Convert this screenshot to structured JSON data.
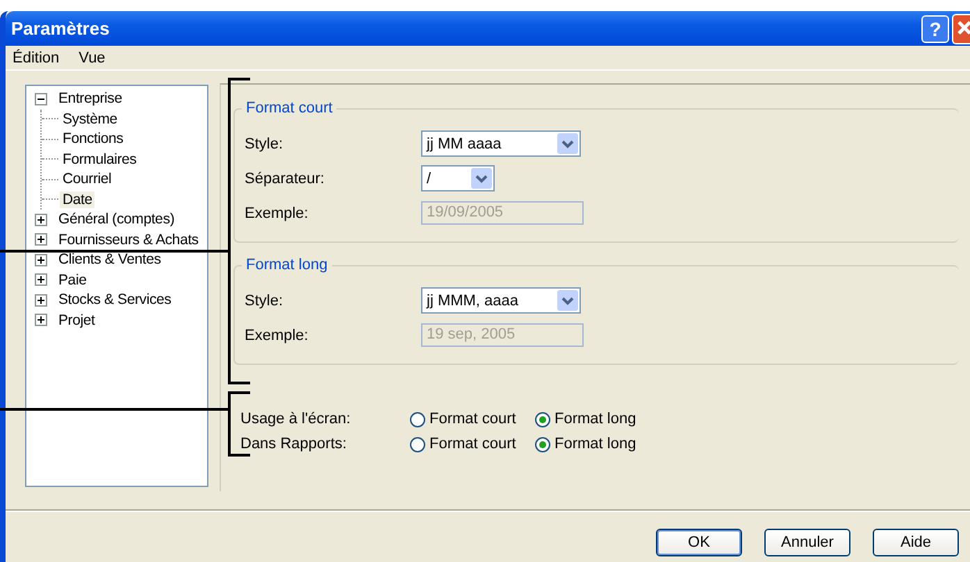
{
  "window": {
    "title": "Paramètres",
    "help_button": "?"
  },
  "menu": [
    "Édition",
    "Vue"
  ],
  "tree": [
    {
      "label": "Entreprise",
      "expanded": true,
      "selected": false,
      "children": [
        {
          "label": "Système",
          "selected": false
        },
        {
          "label": "Fonctions",
          "selected": false
        },
        {
          "label": "Formulaires",
          "selected": false
        },
        {
          "label": "Courriel",
          "selected": false
        },
        {
          "label": "Date",
          "selected": true
        }
      ]
    },
    {
      "label": "Général (comptes)",
      "expanded": false,
      "selected": false
    },
    {
      "label": "Fournisseurs & Achats",
      "expanded": false,
      "selected": false
    },
    {
      "label": "Clients & Ventes",
      "expanded": false,
      "selected": false
    },
    {
      "label": "Paie",
      "expanded": false,
      "selected": false
    },
    {
      "label": "Stocks & Services",
      "expanded": false,
      "selected": false
    },
    {
      "label": "Projet",
      "expanded": false,
      "selected": false
    }
  ],
  "groups": [
    {
      "title": "Format court",
      "fields": [
        {
          "kind": "dropdown",
          "label": "Style:",
          "value": "jj MM aaaa"
        },
        {
          "kind": "small_dropdown",
          "label": "Séparateur:",
          "value": "/"
        },
        {
          "kind": "readonly",
          "label": "Exemple:",
          "value": "19/09/2005"
        }
      ]
    },
    {
      "title": "Format long",
      "fields": [
        {
          "kind": "dropdown",
          "label": "Style:",
          "value": "jj MMM, aaaa"
        },
        {
          "kind": "readonly",
          "label": "Exemple:",
          "value": "19 sep, 2005"
        }
      ]
    }
  ],
  "usage": [
    {
      "label": "Usage à l'écran:",
      "options": [
        {
          "label": "Format court",
          "selected": false
        },
        {
          "label": "Format long",
          "selected": true
        }
      ]
    },
    {
      "label": "Dans Rapports:",
      "options": [
        {
          "label": "Format court",
          "selected": false
        },
        {
          "label": "Format long",
          "selected": true
        }
      ]
    }
  ],
  "buttons": [
    {
      "label": "OK",
      "default": true
    },
    {
      "label": "Annuler",
      "default": false
    },
    {
      "label": "Aide",
      "default": false
    }
  ]
}
